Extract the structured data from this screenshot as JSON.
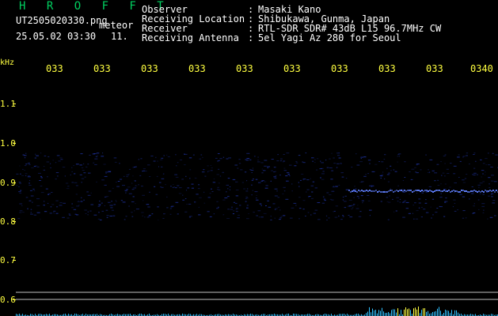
{
  "app": {
    "title": "H R O F F T",
    "filename": "UT2505020330.png",
    "filename_suffix": "meteor",
    "datetime": "25.05.02 03:30",
    "count": "11."
  },
  "header": {
    "fields": [
      {
        "label": "Observer",
        "value": "Masaki Kano"
      },
      {
        "label": "Receiving Location",
        "value": "Shibukawa, Gunma, Japan"
      },
      {
        "label": "Receiver",
        "value": "RTL-SDR SDR# 43dB L15 96.7MHz CW"
      },
      {
        "label": "Receiving Antenna",
        "value": "5el Yagi Az 280 for Seoul"
      }
    ],
    "separator": ":"
  },
  "axes": {
    "y_unit": "kHz",
    "y_ticks": [
      "1.1",
      "1.0",
      "0.9",
      "0.8",
      "0.7",
      "0.6"
    ],
    "x_ticks": [
      "033",
      "033",
      "033",
      "033",
      "033",
      "033",
      "033",
      "033",
      "033",
      "0340"
    ]
  },
  "colors": {
    "background": "#000000",
    "label_yellow": "#ffff40",
    "title_green": "#00d060",
    "text_white": "#ffffff",
    "signal_blue": "#3050ff",
    "meteor_trace": "#6080ff",
    "level_cyan": "#30c0ff"
  }
}
